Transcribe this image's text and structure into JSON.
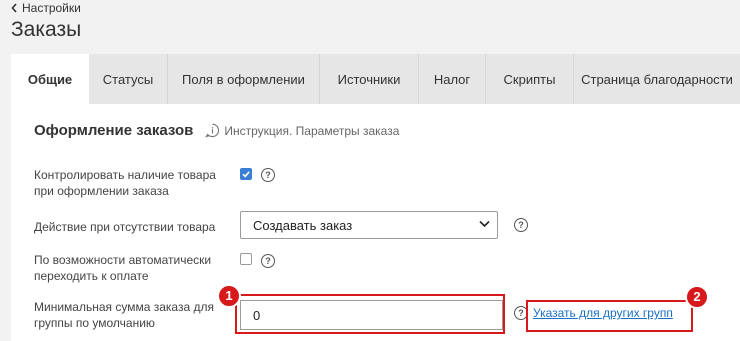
{
  "nav": {
    "back_label": "Настройки"
  },
  "page": {
    "title": "Заказы"
  },
  "tabs": [
    {
      "label": "Общие",
      "active": true
    },
    {
      "label": "Статусы",
      "active": false
    },
    {
      "label": "Поля в оформлении",
      "active": false
    },
    {
      "label": "Источники",
      "active": false
    },
    {
      "label": "Налог",
      "active": false
    },
    {
      "label": "Скрипты",
      "active": false
    },
    {
      "label": "Страница благодарности",
      "active": false
    }
  ],
  "section": {
    "title": "Оформление заказов",
    "hint": "Инструкция. Параметры заказа",
    "hint_icon": "info-bubble-icon"
  },
  "settings": {
    "check_stock": {
      "label": "Контролировать наличие товара при оформлении заказа",
      "checked": true
    },
    "no_stock_action": {
      "label": "Действие при отсутствии товара",
      "selected": "Создавать заказ"
    },
    "auto_pay": {
      "label": "По возможности автоматически переходить к оплате",
      "checked": false
    },
    "min_amount": {
      "label": "Минимальная сумма заказа для группы по умолчанию",
      "value": "0"
    },
    "other_groups_link": "Указать для других групп",
    "help_glyph": "?"
  },
  "annotations": {
    "badge_1": "1",
    "badge_2": "2",
    "color": "#d7191c"
  },
  "colors": {
    "accent_blue": "#3a7fd5",
    "link": "#1a6fc4",
    "background": "#f2f2f2"
  }
}
